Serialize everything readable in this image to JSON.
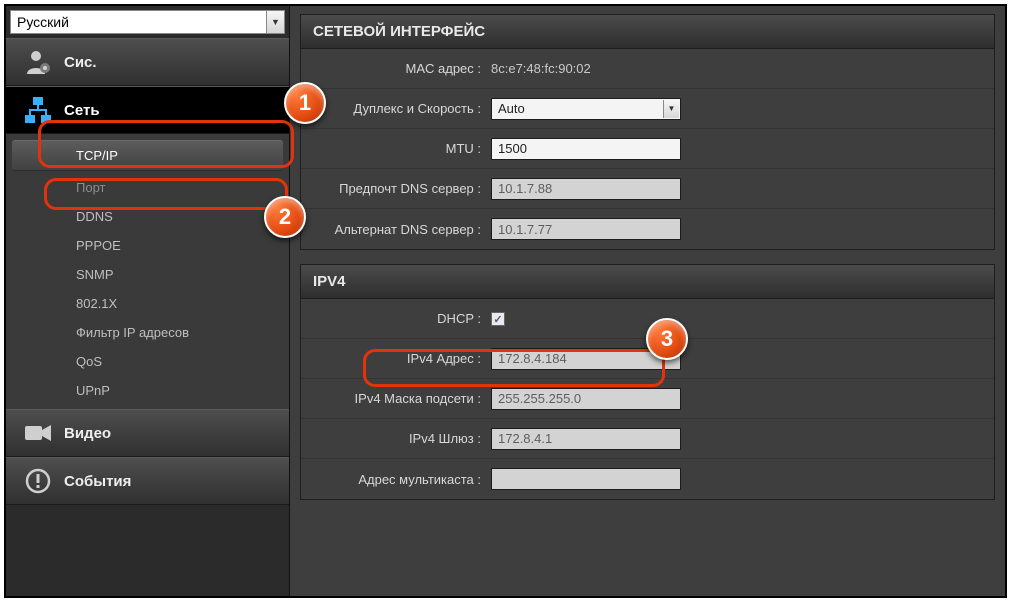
{
  "language": "Русский",
  "sidebar": {
    "system": "Сис.",
    "network": "Сеть",
    "video": "Видео",
    "events": "События",
    "sub": {
      "tcpip": "TCP/IP",
      "port": "Порт",
      "ddns": "DDNS",
      "pppoe": "PPPOE",
      "snmp": "SNMP",
      "dot1x": "802.1X",
      "ipfilter": "Фильтр IP адресов",
      "qos": "QoS",
      "upnp": "UPnP"
    }
  },
  "panels": {
    "net": {
      "title": "СЕТЕВОЙ ИНТЕРФЕЙС",
      "mac_label": "MAC адрес :",
      "mac_value": "8c:e7:48:fc:90:02",
      "duplex_label": "Дуплекс и Скорость :",
      "duplex_value": "Auto",
      "mtu_label": "MTU :",
      "mtu_value": "1500",
      "primdns_label": "Предпочт DNS сервер :",
      "primdns_value": "10.1.7.88",
      "altdns_label": "Альтернат DNS сервер :",
      "altdns_value": "10.1.7.77"
    },
    "ipv4": {
      "title": "IPV4",
      "dhcp_label": "DHCP :",
      "dhcp_checked": true,
      "addr_label": "IPv4 Адрес :",
      "addr_value": "172.8.4.184",
      "mask_label": "IPv4 Маска подсети :",
      "mask_value": "255.255.255.0",
      "gw_label": "IPv4 Шлюз :",
      "gw_value": "172.8.4.1",
      "mcast_label": "Адрес мультикаста :",
      "mcast_value": ""
    }
  },
  "callouts": {
    "c1": "1",
    "c2": "2",
    "c3": "3"
  }
}
